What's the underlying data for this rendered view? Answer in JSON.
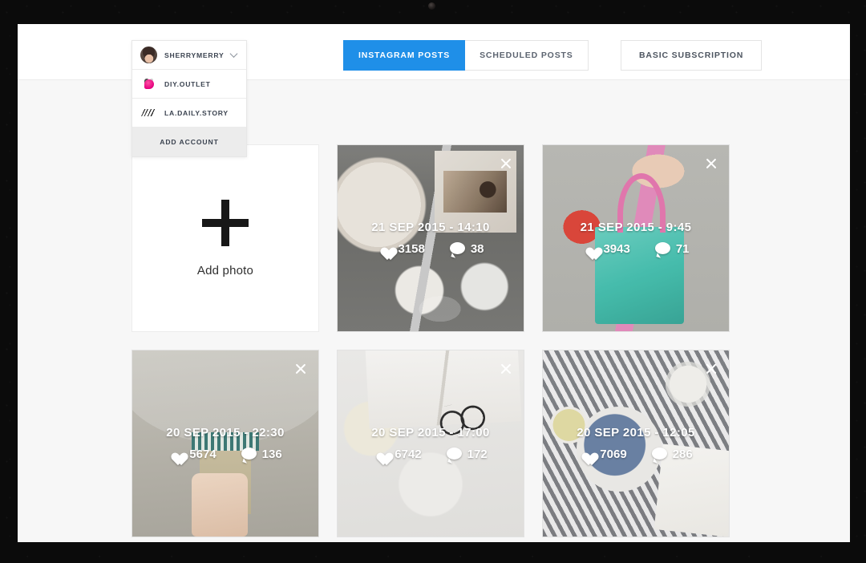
{
  "window": {
    "header": {
      "tabs": [
        {
          "label": "INSTAGRAM POSTS",
          "active": true
        },
        {
          "label": "SCHEDULED POSTS",
          "active": false
        }
      ],
      "subscription_button": "BASIC SUBSCRIPTION"
    },
    "account_dropdown": {
      "selected": "SHERRYMERRY",
      "items": [
        {
          "label": "SHERRYMERRY",
          "avatar": "photo-avatar",
          "has_chevron": true
        },
        {
          "label": "DIY.OUTLET",
          "avatar": "sewing-machine-avatar",
          "has_chevron": false
        },
        {
          "label": "LA.DAILY.STORY",
          "avatar": "script-logo-avatar",
          "has_chevron": false
        }
      ],
      "add_account_label": "ADD ACCOUNT"
    },
    "content": {
      "add_photo": {
        "label": "Add photo",
        "icon": "plus-icon"
      },
      "posts": [
        {
          "date": "21 SEP 2015 - 14:10",
          "likes": "3158",
          "comments": "38",
          "image_alt": "breakfast-crepe-flatlay",
          "close_label": "×"
        },
        {
          "date": "21 SEP 2015 - 9:45",
          "likes": "3943",
          "comments": "71",
          "image_alt": "teal-tote-bag",
          "close_label": "×"
        },
        {
          "date": "20 SEP 2015 - 22:30",
          "likes": "5674",
          "comments": "136",
          "image_alt": "hand-holding-jam-jar",
          "close_label": "×"
        },
        {
          "date": "20 SEP 2015 - 17:00",
          "likes": "6742",
          "comments": "172",
          "image_alt": "book-glasses-pastries",
          "close_label": "×"
        },
        {
          "date": "20 SEP 2015 - 12:05",
          "likes": "7069",
          "comments": "286",
          "image_alt": "striped-napkin-plate-flatlay",
          "close_label": "×"
        }
      ]
    }
  },
  "colors": {
    "accent_blue": "#1f8fe8",
    "header_bg": "#ffffff",
    "content_bg": "#f7f7f7",
    "border": "#e4e4e4",
    "text_dark": "#3b4350",
    "bezel": "#0b0b0b"
  }
}
